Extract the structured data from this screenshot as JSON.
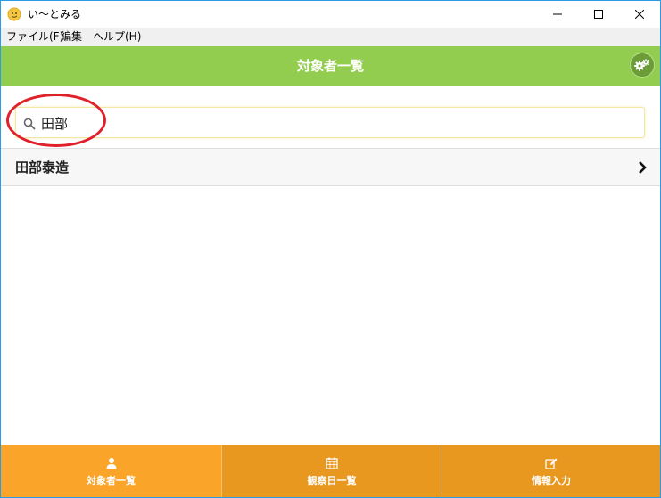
{
  "window": {
    "title": "い〜とみる"
  },
  "menu": {
    "file": "ファイル(F)",
    "edit": "編集",
    "help": "ヘルプ(H)"
  },
  "header": {
    "title": "対象者一覧"
  },
  "search": {
    "value": "田部",
    "placeholder": ""
  },
  "list": {
    "items": [
      {
        "name": "田部泰造"
      }
    ]
  },
  "tabs": [
    {
      "label": "対象者一覧",
      "icon": "user-icon"
    },
    {
      "label": "観察日一覧",
      "icon": "calendar-icon"
    },
    {
      "label": "情報入力",
      "icon": "edit-icon"
    }
  ],
  "colors": {
    "header_bg": "#93cd4f",
    "tab_active": "#fba42a",
    "tab_inactive": "#e8981f",
    "annotation": "#e0202a"
  }
}
